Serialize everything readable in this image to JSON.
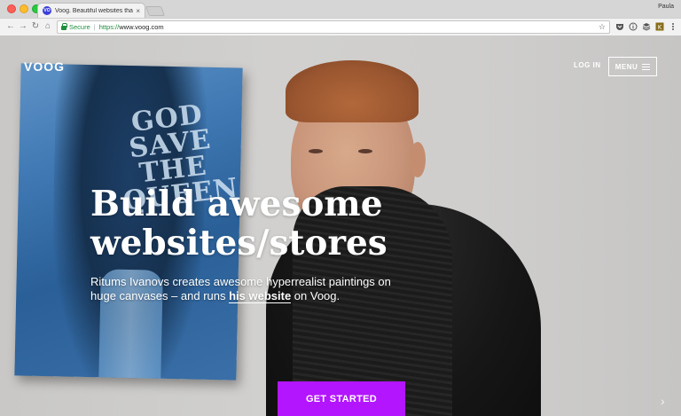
{
  "browser": {
    "tab_title": "Voog. Beautiful websites that",
    "tab_close": "×",
    "tab_favicon": "VO",
    "profile_name": "Paula",
    "secure_label": "Secure",
    "url_scheme": "https://",
    "url_host": "www.voog.com",
    "nav": {
      "back": "←",
      "forward": "→",
      "reload": "↻",
      "home": "⌂"
    },
    "star": "☆",
    "extensions": [
      "pocket-icon",
      "info-icon",
      "layers-icon",
      "extension-icon",
      "more-icon"
    ]
  },
  "site": {
    "logo": "VOOG",
    "login_label": "LOG IN",
    "menu_label": "MENU",
    "painting_text": "GOD SAVE THE QUEEN",
    "hero_title_line1": "Build awesome",
    "hero_title_line2": "websites/stores",
    "hero_sub_pre": "Ritums Ivanovs creates awesome hyperrealist paintings on huge canvases – and runs ",
    "hero_sub_link": "his website",
    "hero_sub_post": " on Voog.",
    "cta_label": "GET STARTED",
    "next_arrow": "›"
  },
  "colors": {
    "cta": "#b315ff",
    "secure": "#1e8e3e"
  }
}
